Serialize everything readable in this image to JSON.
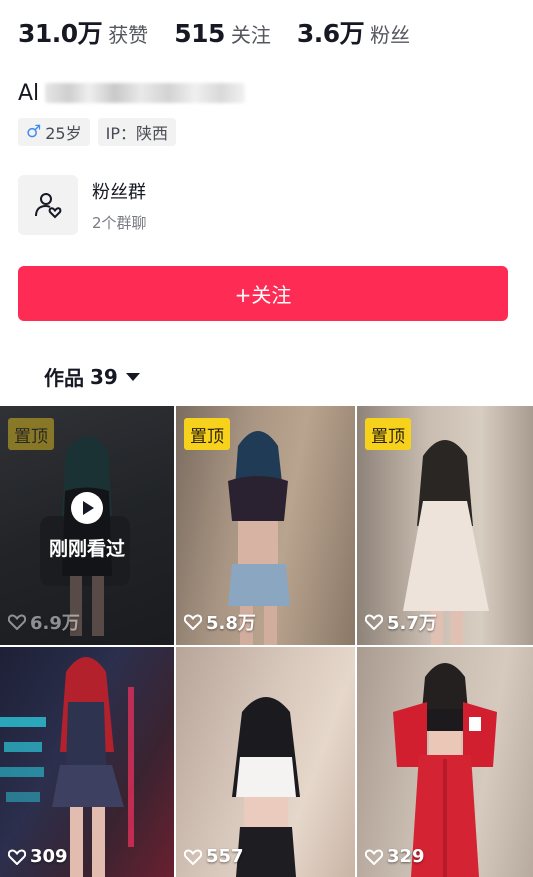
{
  "stats": [
    {
      "value": "31.0万",
      "label": "获赞"
    },
    {
      "value": "515",
      "label": "关注"
    },
    {
      "value": "3.6万",
      "label": "粉丝"
    }
  ],
  "profile": {
    "name_visible": "Al"
  },
  "tags": {
    "gender_icon": "♂",
    "age": "25岁",
    "ip": "IP：陕西"
  },
  "fan_group": {
    "icon": "people-heart-icon",
    "title": "粉丝群",
    "subtitle": "2个群聊"
  },
  "follow_button": {
    "label": "+关注",
    "color": "#fe2c55"
  },
  "works_tab": {
    "label": "作品",
    "count": "39"
  },
  "videos": [
    {
      "pinned": true,
      "pin_label": "置顶",
      "likes": "6.9万",
      "just_watched": true,
      "just_watched_label": "刚刚看过",
      "bg": "#5a5f68"
    },
    {
      "pinned": true,
      "pin_label": "置顶",
      "likes": "5.8万",
      "just_watched": false,
      "bg": "#9a8878"
    },
    {
      "pinned": true,
      "pin_label": "置顶",
      "likes": "5.7万",
      "just_watched": false,
      "bg": "#b8aaa0"
    },
    {
      "pinned": false,
      "likes": "309",
      "just_watched": false,
      "bg": "#2a2d44"
    },
    {
      "pinned": false,
      "likes": "557",
      "just_watched": false,
      "bg": "#c7b4a8"
    },
    {
      "pinned": false,
      "likes": "329",
      "just_watched": false,
      "bg": "#bfb2a6"
    }
  ],
  "colors": {
    "accent": "#fe2c55",
    "pin": "#f7d21c"
  }
}
